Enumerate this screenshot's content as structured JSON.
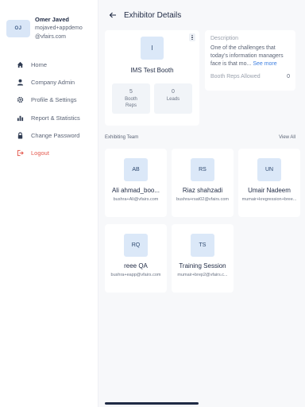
{
  "profile": {
    "initials": "OJ",
    "name": "Omer Javed",
    "email_line1": "mojaved+appdemo",
    "email_line2": "@vfairs.com"
  },
  "sidebar": {
    "items": [
      {
        "label": "Home",
        "icon": "home-icon"
      },
      {
        "label": "Company Admin",
        "icon": "user-icon"
      },
      {
        "label": "Profile & Settings",
        "icon": "gear-icon"
      },
      {
        "label": "Report & Statistics",
        "icon": "bar-chart-icon"
      },
      {
        "label": "Change Password",
        "icon": "lock-icon"
      },
      {
        "label": "Logout",
        "icon": "logout-icon"
      }
    ],
    "logout_color": "#e45a4f"
  },
  "header": {
    "title": "Exhibitor Details"
  },
  "booth": {
    "logo_letter": "I",
    "name": "IMS Test Booth",
    "booth_reps_value": "5",
    "booth_reps_label_1": "Booth",
    "booth_reps_label_2": "Reps",
    "leads_value": "0",
    "leads_label": "Leads"
  },
  "description": {
    "label": "Description",
    "text": "One of the challenges that today's information managers face is that mo...",
    "see_more": "See more",
    "reps_allowed_label": "Booth Reps Allowed",
    "reps_allowed_value": "0"
  },
  "team": {
    "section_title": "Exhibiting Team",
    "view_all": "View All",
    "members": [
      {
        "initials": "AB",
        "name": "Ali ahmad_boo...",
        "email": "bushra+Ali@vfairs.com"
      },
      {
        "initials": "RS",
        "name": "Riaz shahzadi",
        "email": "bushra+rsat02@vfairs.com"
      },
      {
        "initials": "UN",
        "name": "Umair Nadeem",
        "email": "mumair+kregression+bree..."
      },
      {
        "initials": "RQ",
        "name": "reee QA",
        "email": "bushra+eapp@vfairs.com"
      },
      {
        "initials": "TS",
        "name": "Training Session",
        "email": "mumair+brep2@vfairs.c..."
      }
    ]
  },
  "colors": {
    "accent": "#3d7fe0",
    "avatar_bg": "#dbe8f8",
    "main_bg": "#f7f8fa"
  }
}
